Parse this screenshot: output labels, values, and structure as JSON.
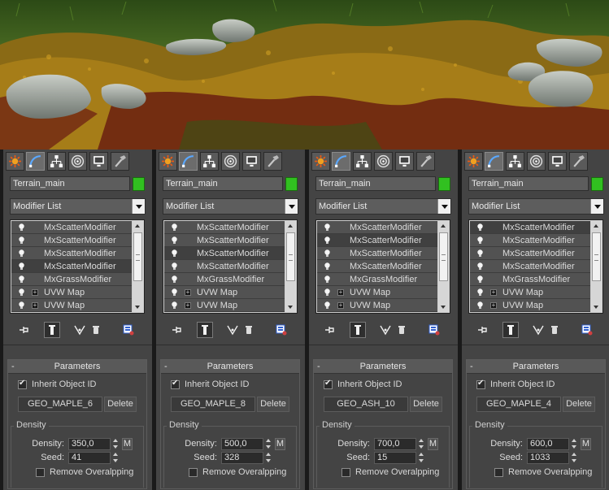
{
  "colors": {
    "accent_green": "#31c020",
    "panel_bg": "#444444",
    "stack_row": "#525252"
  },
  "command_tabs": [
    {
      "name": "create-icon"
    },
    {
      "name": "modify-icon"
    },
    {
      "name": "hierarchy-icon"
    },
    {
      "name": "motion-icon"
    },
    {
      "name": "display-icon"
    },
    {
      "name": "utilities-icon"
    }
  ],
  "stack_tools": [
    "pin-stack-icon",
    "show-end-result-icon",
    "make-unique-icon",
    "remove-modifier-icon",
    "configure-modifier-sets-icon"
  ],
  "panels": [
    {
      "object_name": "Terrain_main",
      "modifier_list": "Modifier List",
      "stack": [
        {
          "label": "MxScatterModifier",
          "expand": false
        },
        {
          "label": "MxScatterModifier",
          "expand": false
        },
        {
          "label": "MxScatterModifier",
          "expand": false
        },
        {
          "label": "MxScatterModifier",
          "expand": false
        },
        {
          "label": "MxGrassModifier",
          "expand": false
        },
        {
          "label": "UVW Map",
          "expand": true
        },
        {
          "label": "UVW Map",
          "expand": true
        }
      ],
      "selected_row": 3,
      "rollout_title": "Parameters",
      "rollout_toggle": "-",
      "inherit_label": "Inherit Object ID",
      "geo_name": "GEO_MAPLE_6",
      "delete_label": "Delete",
      "group_label": "Density",
      "density_label": "Density:",
      "density_value": "350,0",
      "m_label": "M",
      "seed_label": "Seed:",
      "seed_value": "41",
      "remove_label": "Remove Overalpping"
    },
    {
      "object_name": "Terrain_main",
      "modifier_list": "Modifier List",
      "stack": [
        {
          "label": "MxScatterModifier",
          "expand": false
        },
        {
          "label": "MxScatterModifier",
          "expand": false
        },
        {
          "label": "MxScatterModifier",
          "expand": false
        },
        {
          "label": "MxScatterModifier",
          "expand": false
        },
        {
          "label": "MxGrassModifier",
          "expand": false
        },
        {
          "label": "UVW Map",
          "expand": true
        },
        {
          "label": "UVW Map",
          "expand": true
        }
      ],
      "selected_row": 2,
      "rollout_title": "Parameters",
      "rollout_toggle": "-",
      "inherit_label": "Inherit Object ID",
      "geo_name": "GEO_MAPLE_8",
      "delete_label": "Delete",
      "group_label": "Density",
      "density_label": "Density:",
      "density_value": "500,0",
      "m_label": "M",
      "seed_label": "Seed:",
      "seed_value": "328",
      "remove_label": "Remove Overalpping"
    },
    {
      "object_name": "Terrain_main",
      "modifier_list": "Modifier List",
      "stack": [
        {
          "label": "MxScatterModifier",
          "expand": false
        },
        {
          "label": "MxScatterModifier",
          "expand": false
        },
        {
          "label": "MxScatterModifier",
          "expand": false
        },
        {
          "label": "MxScatterModifier",
          "expand": false
        },
        {
          "label": "MxGrassModifier",
          "expand": false
        },
        {
          "label": "UVW Map",
          "expand": true
        },
        {
          "label": "UVW Map",
          "expand": true
        }
      ],
      "selected_row": 1,
      "rollout_title": "Parameters",
      "rollout_toggle": "-",
      "inherit_label": "Inherit Object ID",
      "geo_name": "GEO_ASH_10",
      "delete_label": "Delete",
      "group_label": "Density",
      "density_label": "Density:",
      "density_value": "700,0",
      "m_label": "M",
      "seed_label": "Seed:",
      "seed_value": "15",
      "remove_label": "Remove Overalpping"
    },
    {
      "object_name": "Terrain_main",
      "modifier_list": "Modifier List",
      "stack": [
        {
          "label": "MxScatterModifier",
          "expand": false
        },
        {
          "label": "MxScatterModifier",
          "expand": false
        },
        {
          "label": "MxScatterModifier",
          "expand": false
        },
        {
          "label": "MxScatterModifier",
          "expand": false
        },
        {
          "label": "MxGrassModifier",
          "expand": false
        },
        {
          "label": "UVW Map",
          "expand": true
        },
        {
          "label": "UVW Map",
          "expand": true
        }
      ],
      "selected_row": 0,
      "rollout_title": "Parameters",
      "rollout_toggle": "-",
      "inherit_label": "Inherit Object ID",
      "geo_name": "GEO_MAPLE_4",
      "delete_label": "Delete",
      "group_label": "Density",
      "density_label": "Density:",
      "density_value": "600,0",
      "m_label": "M",
      "seed_label": "Seed:",
      "seed_value": "1033",
      "remove_label": "Remove Overalpping"
    }
  ]
}
